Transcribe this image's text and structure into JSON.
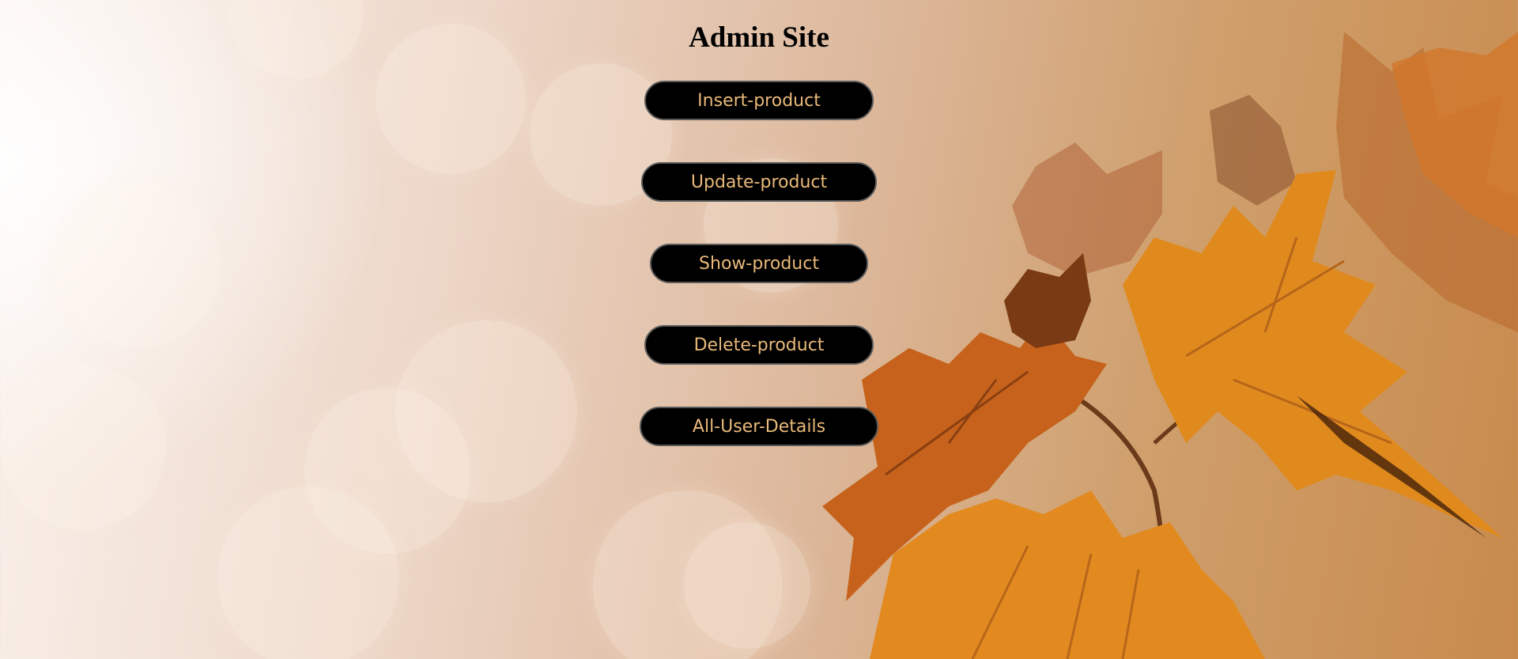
{
  "page": {
    "title": "Admin Site"
  },
  "nav": {
    "buttons": [
      {
        "label": "Insert-product"
      },
      {
        "label": "Update-product"
      },
      {
        "label": "Show-product"
      },
      {
        "label": "Delete-product"
      },
      {
        "label": "All-User-Details"
      }
    ]
  },
  "colors": {
    "button_background": "#000000",
    "button_text": "#e9b97a",
    "title_text": "#000000"
  }
}
